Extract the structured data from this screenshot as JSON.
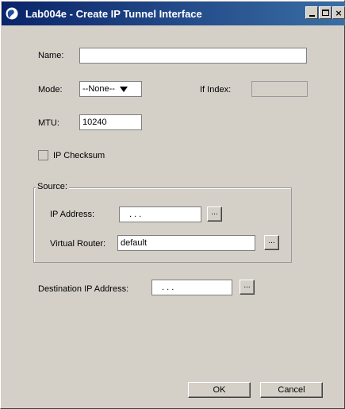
{
  "window": {
    "title": "Lab004e - Create IP Tunnel Interface",
    "title_icon": "globe-icon",
    "colors": {
      "titlebar_start": "#0a246a",
      "titlebar_end": "#3a6ea5",
      "background": "#d4d0c8"
    },
    "controls": {
      "minimize": "minimize-icon",
      "maximize": "maximize-icon",
      "close": "×"
    }
  },
  "form": {
    "name": {
      "label": "Name:",
      "value": ""
    },
    "mode": {
      "label": "Mode:",
      "selected": "--None--"
    },
    "if_index": {
      "label": "If Index:",
      "value": ""
    },
    "mtu": {
      "label": "MTU:",
      "value": "10240"
    },
    "ip_checksum": {
      "label": "IP Checksum",
      "checked": false
    },
    "source": {
      "legend": "Source:",
      "ip_address": {
        "label": "IP Address:",
        "value": ". . ."
      },
      "virtual_router": {
        "label": "Virtual Router:",
        "value": "default"
      }
    },
    "destination": {
      "label": "Destination IP Address:",
      "value": ". . ."
    },
    "ellipsis_label": "..."
  },
  "buttons": {
    "ok": "OK",
    "cancel": "Cancel"
  }
}
